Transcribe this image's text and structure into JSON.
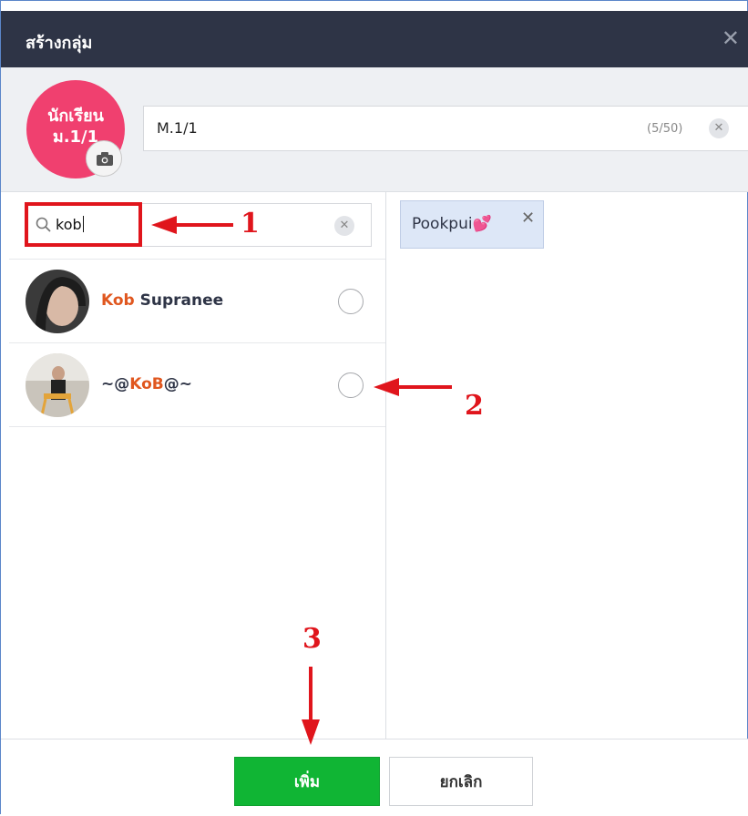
{
  "dialog": {
    "title": "สร้างกลุ่ม",
    "close_icon": "close-icon"
  },
  "group": {
    "avatar_text_line1": "นักเรียน",
    "avatar_text_line2": "ม.1/1",
    "avatar_color": "#f0406f",
    "name_value": "M.1/1",
    "name_counter": "(5/50)"
  },
  "search": {
    "query": "kob"
  },
  "results": [
    {
      "highlight": "Kob",
      "rest": " Supranee",
      "prefix": ""
    },
    {
      "prefix": "~@",
      "highlight": "KoB",
      "rest": "@~"
    }
  ],
  "selected": {
    "chip_label": "Pookpui💕"
  },
  "footer": {
    "add_label": "เพิ่ม",
    "cancel_label": "ยกเลิก"
  },
  "annotations": {
    "step1": "1",
    "step2": "2",
    "step3": "3"
  },
  "colors": {
    "titlebar": "#2e3446",
    "highlight": "#e0571f",
    "primary_button": "#10b534",
    "annotation_red": "#e0151c",
    "chip_bg": "#dde7f7"
  }
}
